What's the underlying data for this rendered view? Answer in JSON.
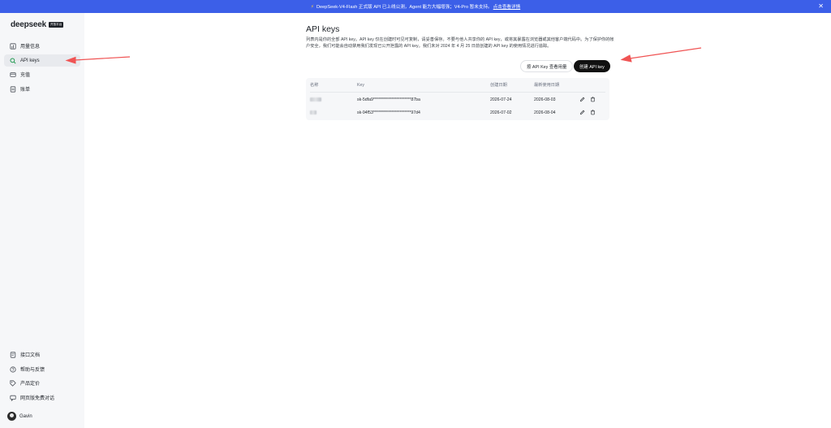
{
  "banner": {
    "text": "DeepSeek-V4-Flash 正式版 API 已上线公测，Agent 能力大幅增强；V4-Pro 暂未支持。",
    "link": "点击查看详情",
    "bolt_color": "#ffcf3f",
    "bg_color": "#3c5fe8"
  },
  "brand": {
    "name": "deepseek",
    "badge": "开放平台"
  },
  "nav_top": [
    {
      "label": "用量信息",
      "icon": "chart-icon"
    },
    {
      "label": "API keys",
      "icon": "search-icon",
      "active": true
    },
    {
      "label": "充值",
      "icon": "wallet-icon"
    },
    {
      "label": "账单",
      "icon": "bill-icon"
    }
  ],
  "nav_bottom": [
    {
      "label": "接口文档",
      "icon": "doc-icon"
    },
    {
      "label": "帮助与反馈",
      "icon": "help-icon"
    },
    {
      "label": "产品定价",
      "icon": "tag-icon"
    },
    {
      "label": "网页版免费对话",
      "icon": "chat-icon"
    }
  ],
  "user": {
    "name": "Gavin"
  },
  "page": {
    "title": "API keys",
    "description": "列表内是你的全部 API key。API key 仅在创建时可见可复制，请妥善保存。不要与他人共享你的 API key，或将其暴露在浏览器或其他客户端代码中。为了保护你的帐户安全，我们可能会自动禁用我们发现已公开泄露的 API key。我们未对 2024 年 4 月 25 日前创建的 API key 的使用情况进行追踪。"
  },
  "buttons": {
    "usage_by_key": "按 API Key 查看用量",
    "create": "创建 API key"
  },
  "table": {
    "columns": [
      "名称",
      "Key",
      "创建日期",
      "最新使用日期"
    ],
    "rows": [
      {
        "key": "sk-5dfa9***********************87ba",
        "created": "2026-07-24",
        "last_used": "2026-08-03"
      },
      {
        "key": "sk-94f53***********************97d4",
        "created": "2026-07-02",
        "last_used": "2026-08-04"
      }
    ]
  },
  "annotation": {
    "arrow_color": "#f05454"
  }
}
